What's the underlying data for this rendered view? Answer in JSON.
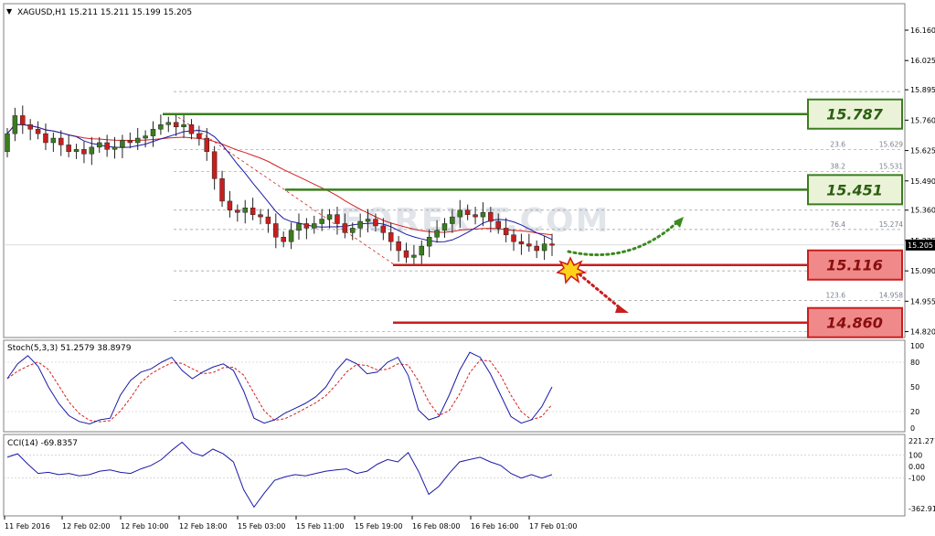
{
  "chart_data": {
    "type": "candlestick",
    "symbol_header": "XAGUSD,H1  15.211 15.211 15.199 15.205",
    "price_axis_ticks": [
      "16.160",
      "16.025",
      "15.895",
      "15.760",
      "15.625",
      "15.490",
      "15.360",
      "15.225",
      "15.090",
      "14.955",
      "14.820"
    ],
    "current_price": "15.205",
    "x_tick_labels": [
      "11 Feb 2016",
      "12 Feb 02:00",
      "12 Feb 10:00",
      "12 Feb 18:00",
      "15 Feb 03:00",
      "15 Feb 11:00",
      "15 Feb 19:00",
      "16 Feb 08:00",
      "16 Feb 16:00",
      "17 Feb 01:00"
    ],
    "levels": [
      {
        "label": "15.787",
        "value": 15.787,
        "kind": "resistance",
        "color": "#3a7d1e"
      },
      {
        "label": "15.451",
        "value": 15.451,
        "kind": "resistance",
        "color": "#3a7d1e"
      },
      {
        "label": "15.116",
        "value": 15.116,
        "kind": "support",
        "color": "#c81e1e"
      },
      {
        "label": "14.860",
        "value": 14.86,
        "kind": "support",
        "color": "#c81e1e"
      }
    ],
    "fibonacci": [
      {
        "ratio": "23.6",
        "value": "15.629"
      },
      {
        "ratio": "38.2",
        "value": "15.531"
      },
      {
        "ratio": "76.4",
        "value": "15.274"
      },
      {
        "ratio": "123.6",
        "value": "14.958"
      }
    ],
    "stochastic": {
      "label": "Stoch(5,3,3) 51.2579 38.8979",
      "axis_ticks": [
        "100",
        "80",
        "50",
        "20",
        "0"
      ]
    },
    "cci": {
      "label": "CCI(14) -69.8357",
      "axis_ticks": [
        "221.277",
        "100",
        "0.00",
        "-100",
        "-362.914"
      ]
    },
    "colors": {
      "bull": "#3a7d1e",
      "bear": "#c81e1e",
      "ma_fast": "#1a1aa8",
      "ma_slow": "#d42020"
    }
  }
}
